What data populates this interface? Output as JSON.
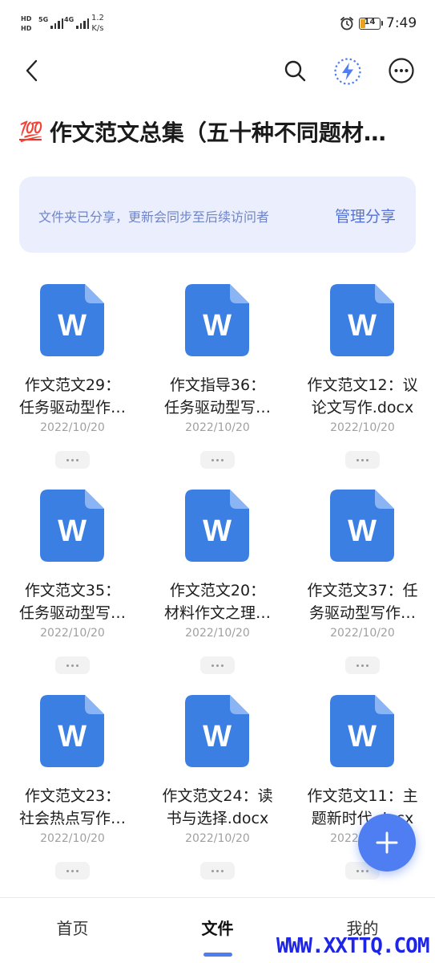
{
  "status_bar": {
    "sim1": "HD",
    "sim2": "HD",
    "signal1_label": "5G",
    "signal2_label": "4G",
    "net_speed_value": "1.2",
    "net_speed_unit": "K/s",
    "battery": "14",
    "battery_color": "#e8a21c",
    "time": "7:49"
  },
  "nav": {
    "back_icon": "chevron-left-icon",
    "search_icon": "search-icon",
    "flash_icon": "lightning-icon",
    "more_icon": "more-horizontal-icon"
  },
  "title": {
    "emoji": "💯",
    "text": "作文范文总集（五十种不同题材…"
  },
  "share_banner": {
    "text": "文件夹已分享，更新会同步至后续访问者",
    "action": "管理分享"
  },
  "files": [
    {
      "name_line1": "作文范文29：",
      "name_line2": "任务驱动型作…",
      "date": "2022/10/20"
    },
    {
      "name_line1": "作文指导36：",
      "name_line2": "任务驱动型写…",
      "date": "2022/10/20"
    },
    {
      "name_line1": "作文范文12：议",
      "name_line2": "论文写作.docx",
      "date": "2022/10/20"
    },
    {
      "name_line1": "作文范文35：",
      "name_line2": "任务驱动型写…",
      "date": "2022/10/20"
    },
    {
      "name_line1": "作文范文20：",
      "name_line2": "材料作文之理…",
      "date": "2022/10/20"
    },
    {
      "name_line1": "作文范文37：任",
      "name_line2": "务驱动型写作…",
      "date": "2022/10/20"
    },
    {
      "name_line1": "作文范文23：",
      "name_line2": "社会热点写作…",
      "date": "2022/10/20"
    },
    {
      "name_line1": "作文范文24：读",
      "name_line2": "书与选择.docx",
      "date": "2022/10/20"
    },
    {
      "name_line1": "作文范文11：主",
      "name_line2": "题新时代.docx",
      "date": "2022/10/20"
    }
  ],
  "file_icon_letter": "W",
  "file_icon_color": "#3b7fe3",
  "tabs": [
    {
      "label": "首页"
    },
    {
      "label": "文件"
    },
    {
      "label": "我的"
    }
  ],
  "accent_color": "#4f7df2",
  "watermark": "WWW.XXTTQ.COM"
}
